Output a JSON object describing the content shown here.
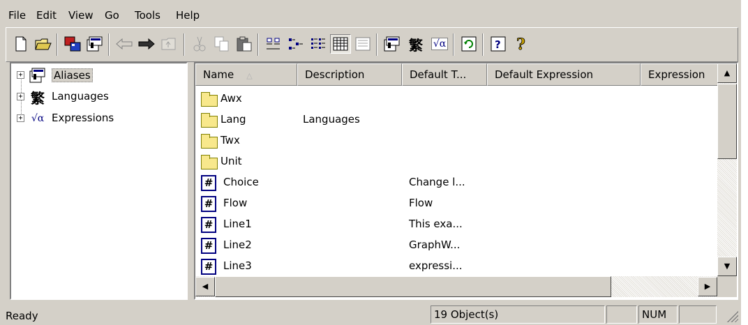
{
  "menu": {
    "file": "File",
    "edit": "Edit",
    "view": "View",
    "go": "Go",
    "tools": "Tools",
    "help": "Help"
  },
  "toolbar": {
    "icons": [
      "new-icon",
      "open-icon",
      "connect-icon",
      "properties-icon",
      "back-icon",
      "forward-icon",
      "up-folder-icon",
      "cut-icon",
      "copy-icon",
      "paste-icon",
      "large-icons-view-icon",
      "small-icons-view-icon",
      "list-view-icon",
      "details-view-icon",
      "preview-view-icon",
      "aliases-icon",
      "languages-icon",
      "expressions-icon",
      "refresh-icon",
      "help-topics-icon",
      "whats-this-icon"
    ],
    "languages_glyph": "繁",
    "expressions_glyph": "√α"
  },
  "tree": {
    "items": [
      {
        "label": "Aliases",
        "icon": "aliases-icon",
        "expander": "+"
      },
      {
        "label": "Languages",
        "icon": "languages-icon",
        "expander": "+"
      },
      {
        "label": "Expressions",
        "icon": "expressions-icon",
        "expander": "+"
      }
    ]
  },
  "list": {
    "columns": [
      "Name",
      "Description",
      "Default T...",
      "Default Expression",
      "Expression"
    ],
    "sort_indicator": "△",
    "rows": [
      {
        "type": "folder",
        "name": "Awx",
        "description": "",
        "default_t": "",
        "default_expression": ""
      },
      {
        "type": "folder",
        "name": "Lang",
        "description": "Languages",
        "default_t": "",
        "default_expression": ""
      },
      {
        "type": "folder",
        "name": "Twx",
        "description": "",
        "default_t": "",
        "default_expression": ""
      },
      {
        "type": "folder",
        "name": "Unit",
        "description": "",
        "default_t": "",
        "default_expression": ""
      },
      {
        "type": "item",
        "name": "Choice",
        "description": "",
        "default_t": "Change l...",
        "default_expression": ""
      },
      {
        "type": "item",
        "name": "Flow",
        "description": "",
        "default_t": "Flow",
        "default_expression": ""
      },
      {
        "type": "item",
        "name": "Line1",
        "description": "",
        "default_t": "This exa...",
        "default_expression": ""
      },
      {
        "type": "item",
        "name": "Line2",
        "description": "",
        "default_t": "GraphW...",
        "default_expression": ""
      },
      {
        "type": "item",
        "name": "Line3",
        "description": "",
        "default_t": "expressi...",
        "default_expression": ""
      }
    ],
    "item_glyph": "#"
  },
  "scroll": {
    "up": "▲",
    "down": "▼",
    "left": "◀",
    "right": "▶"
  },
  "status": {
    "text": "Ready",
    "objects": "19 Object(s)",
    "num": "NUM"
  },
  "colors": {
    "face": "#d4d0c8",
    "folder": "#f8e88c",
    "item_border": "#000080"
  }
}
